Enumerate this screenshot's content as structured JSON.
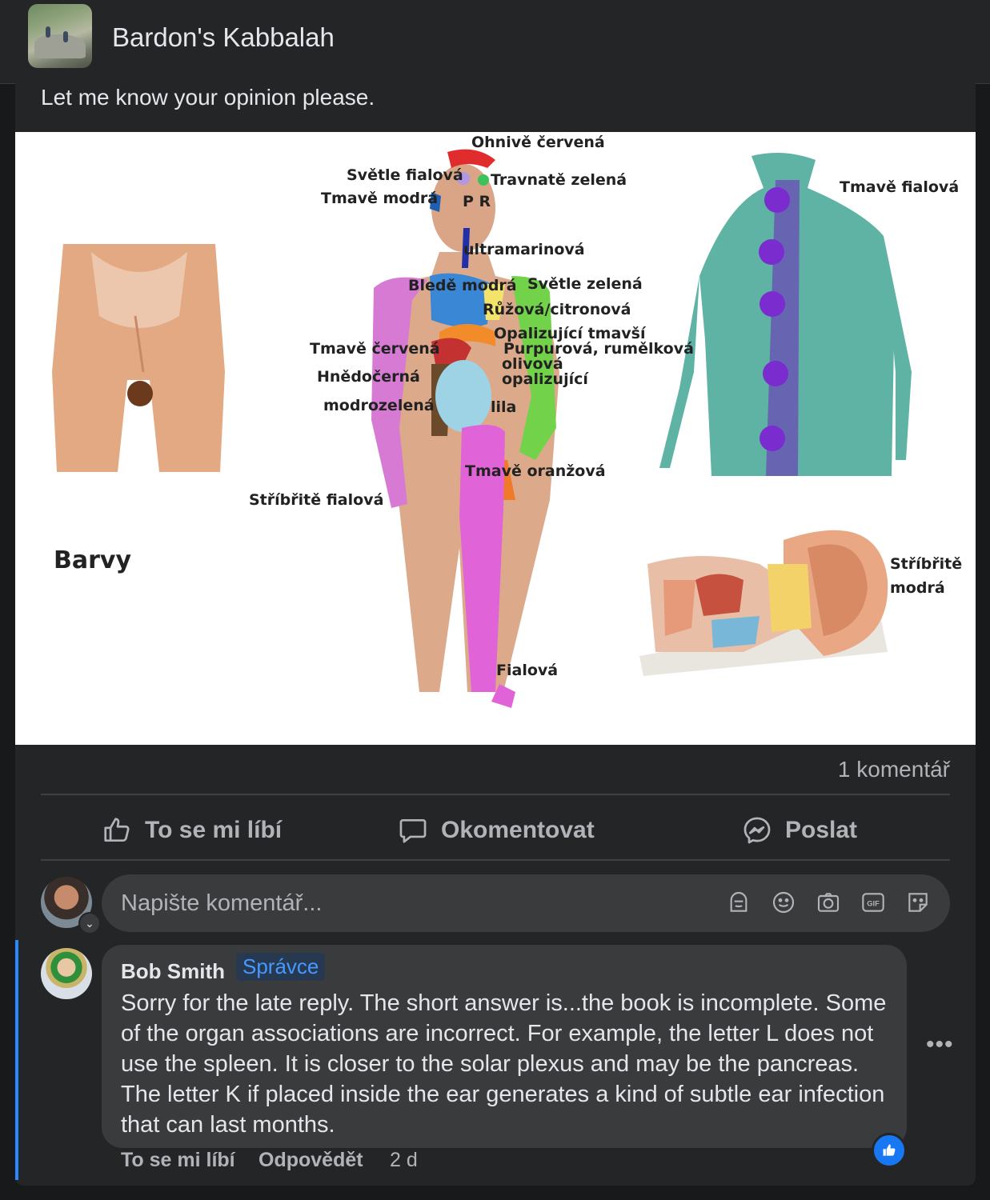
{
  "header": {
    "group_name": "Bardon's Kabbalah"
  },
  "post": {
    "text": "Let me know your opinion please.",
    "image": {
      "title": "Barvy",
      "labels": {
        "ohnive_cervena": "Ohnivě červená",
        "svetle_fialova": "Světle fialová",
        "travnate_zelena": "Travnatě zelená",
        "tmave_modra": "Tmavě modrá",
        "pr": "P R",
        "tmave_fialova": "Tmavě fialová",
        "ultramarinova": "ultramarinová",
        "blede_modra": "Bledě modrá",
        "svetle_zelena": "Světle zelená",
        "ruzova_citronova": "Růžová/citronová",
        "opalizujici_tmavsi": "Opalizující tmavší",
        "tmave_cervena": "Tmavě červená",
        "purpurova": "Purpurová, rumělková",
        "olivova": "olivová",
        "hnedocerna": "Hnědočerná",
        "opalizujici": "opalizující",
        "modrozelena": "modrozelená",
        "lila": "lila",
        "tmave_oranzova": "Tmavě oranžová",
        "stribrite_fialova": "Stříbřitě fialová",
        "stribrite": "Stříbřitě",
        "modra": "modrá",
        "fialova": "Fialová"
      }
    },
    "comment_count": "1 komentář",
    "actions": {
      "like": "To se mi líbí",
      "comment": "Okomentovat",
      "send": "Poslat"
    }
  },
  "composer": {
    "placeholder": "Napište komentář..."
  },
  "comment": {
    "author": "Bob Smith",
    "role_badge": "Správce",
    "text": "Sorry for the late reply. The short answer is...the book is incomplete. Some of the organ associations are incorrect. For example, the letter L does not use the spleen. It is closer to the solar plexus and may be the pancreas. The letter K if placed inside the ear generates a kind of subtle ear infection that can last months.",
    "like_label": "To se mi líbí",
    "reply_label": "Odpovědět",
    "time": "2 d"
  },
  "colors": {
    "accent": "#2d88ff",
    "badge_text": "#4599ff",
    "surface": "#242526",
    "bubble": "#3a3b3c"
  }
}
